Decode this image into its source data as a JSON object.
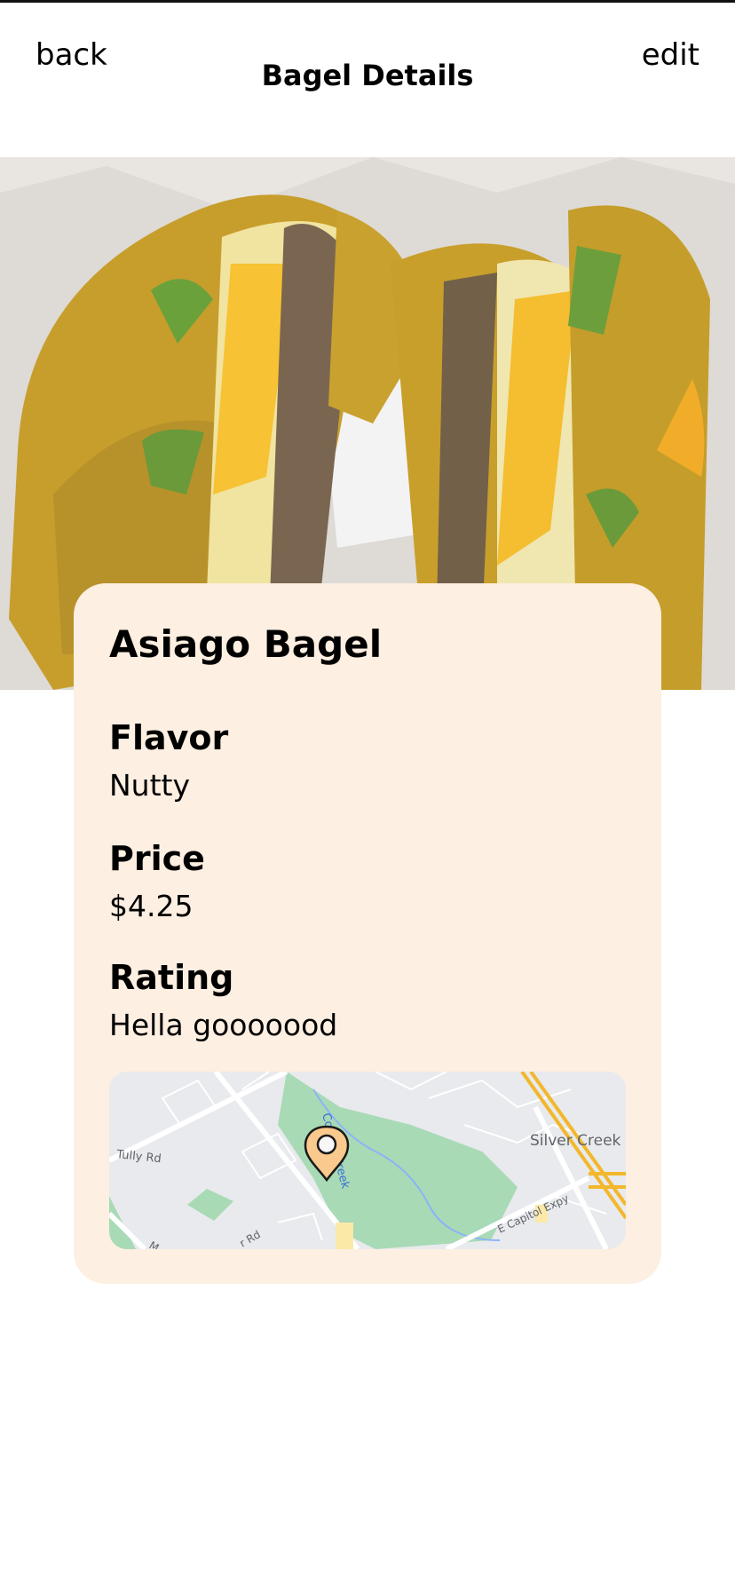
{
  "header": {
    "back_label": "back",
    "title": "Bagel Details",
    "edit_label": "edit"
  },
  "bagel": {
    "name": "Asiago Bagel",
    "flavor_label": "Flavor",
    "flavor_value": "Nutty",
    "price_label": "Price",
    "price_value": "$4.25",
    "rating_label": "Rating",
    "rating_value": "Hella gooooood"
  },
  "map": {
    "labels": {
      "street_tully": "Tully Rd",
      "creek": "Coyote Creek",
      "silver_creek": "Silver Creek H",
      "capitol": "E Capitol Expy",
      "road_rd": "r Rd",
      "road_m": "M"
    },
    "pin_color": "#f9c98d",
    "park_color": "#a8dab5",
    "highway_color": "#f2b72c"
  },
  "colors": {
    "card_bg": "#fdefe1"
  }
}
